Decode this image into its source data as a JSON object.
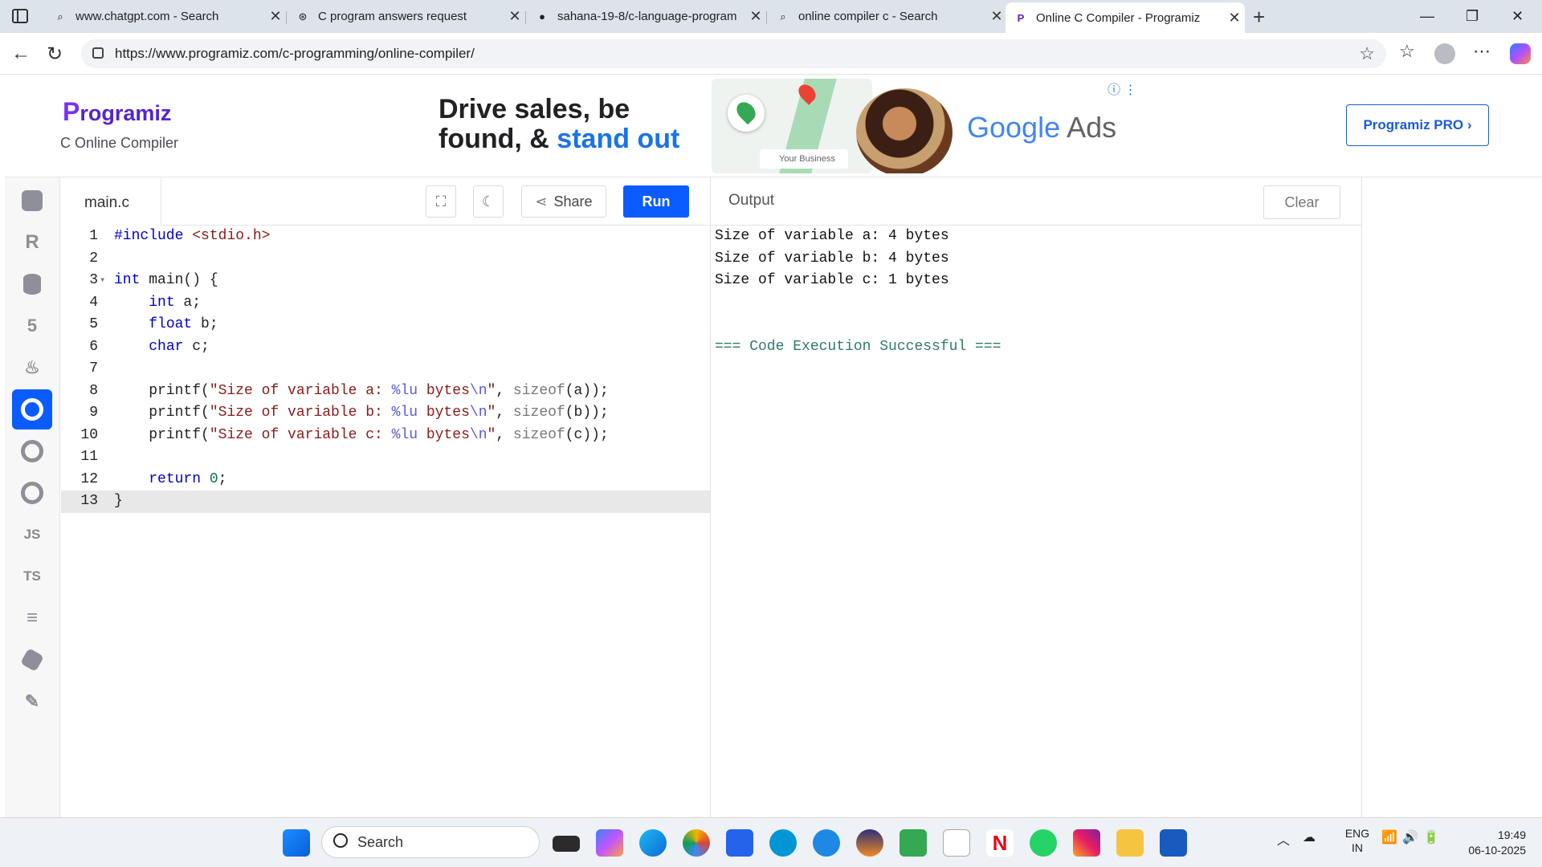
{
  "browser": {
    "tabs": [
      {
        "title": "www.chatgpt.com - Search",
        "icon": "search-icon"
      },
      {
        "title": "C program answers request",
        "icon": "chatgpt-icon"
      },
      {
        "title": "sahana-19-8/c-language-program",
        "icon": "github-icon"
      },
      {
        "title": "online compiler c - Search",
        "icon": "search-icon"
      },
      {
        "title": "Online C Compiler - Programiz",
        "icon": "programiz-icon",
        "active": true
      }
    ],
    "url": "https://www.programiz.com/c-programming/online-compiler/"
  },
  "header": {
    "logo_text": "rogramiz",
    "logo_p": "P",
    "subtitle": "C Online Compiler",
    "pro_button": "Programiz PRO ›"
  },
  "ad": {
    "line1": "Drive sales, be",
    "line2a": "found, & ",
    "line2b": "stand out",
    "badge": "Your Business",
    "brand1": "Google",
    "brand2": " Ads"
  },
  "sidebar": {
    "items": [
      {
        "name": "python-icon",
        "label": ""
      },
      {
        "name": "r-icon",
        "label": ""
      },
      {
        "name": "sql-icon",
        "label": ""
      },
      {
        "name": "html-icon",
        "label": ""
      },
      {
        "name": "java-icon",
        "label": ""
      },
      {
        "name": "c-icon",
        "label": "",
        "active": true
      },
      {
        "name": "csharp-icon",
        "label": ""
      },
      {
        "name": "cpp-icon",
        "label": ""
      },
      {
        "name": "javascript-icon",
        "label": "JS"
      },
      {
        "name": "typescript-icon",
        "label": "TS"
      },
      {
        "name": "stack-icon",
        "label": ""
      },
      {
        "name": "swift-icon",
        "label": ""
      },
      {
        "name": "go-icon",
        "label": ""
      }
    ]
  },
  "editor": {
    "filename": "main.c",
    "share_label": "Share",
    "run_label": "Run",
    "current_line": 13
  },
  "output": {
    "title": "Output",
    "clear_label": "Clear",
    "lines": [
      "Size of variable a: 4 bytes",
      "Size of variable b: 4 bytes",
      "Size of variable c: 1 bytes",
      "",
      "",
      "=== Code Execution Successful ==="
    ]
  },
  "taskbar": {
    "search_placeholder": "Search",
    "lang_line1": "ENG",
    "lang_line2": "IN",
    "time": "19:49",
    "date": "06-10-2025"
  }
}
